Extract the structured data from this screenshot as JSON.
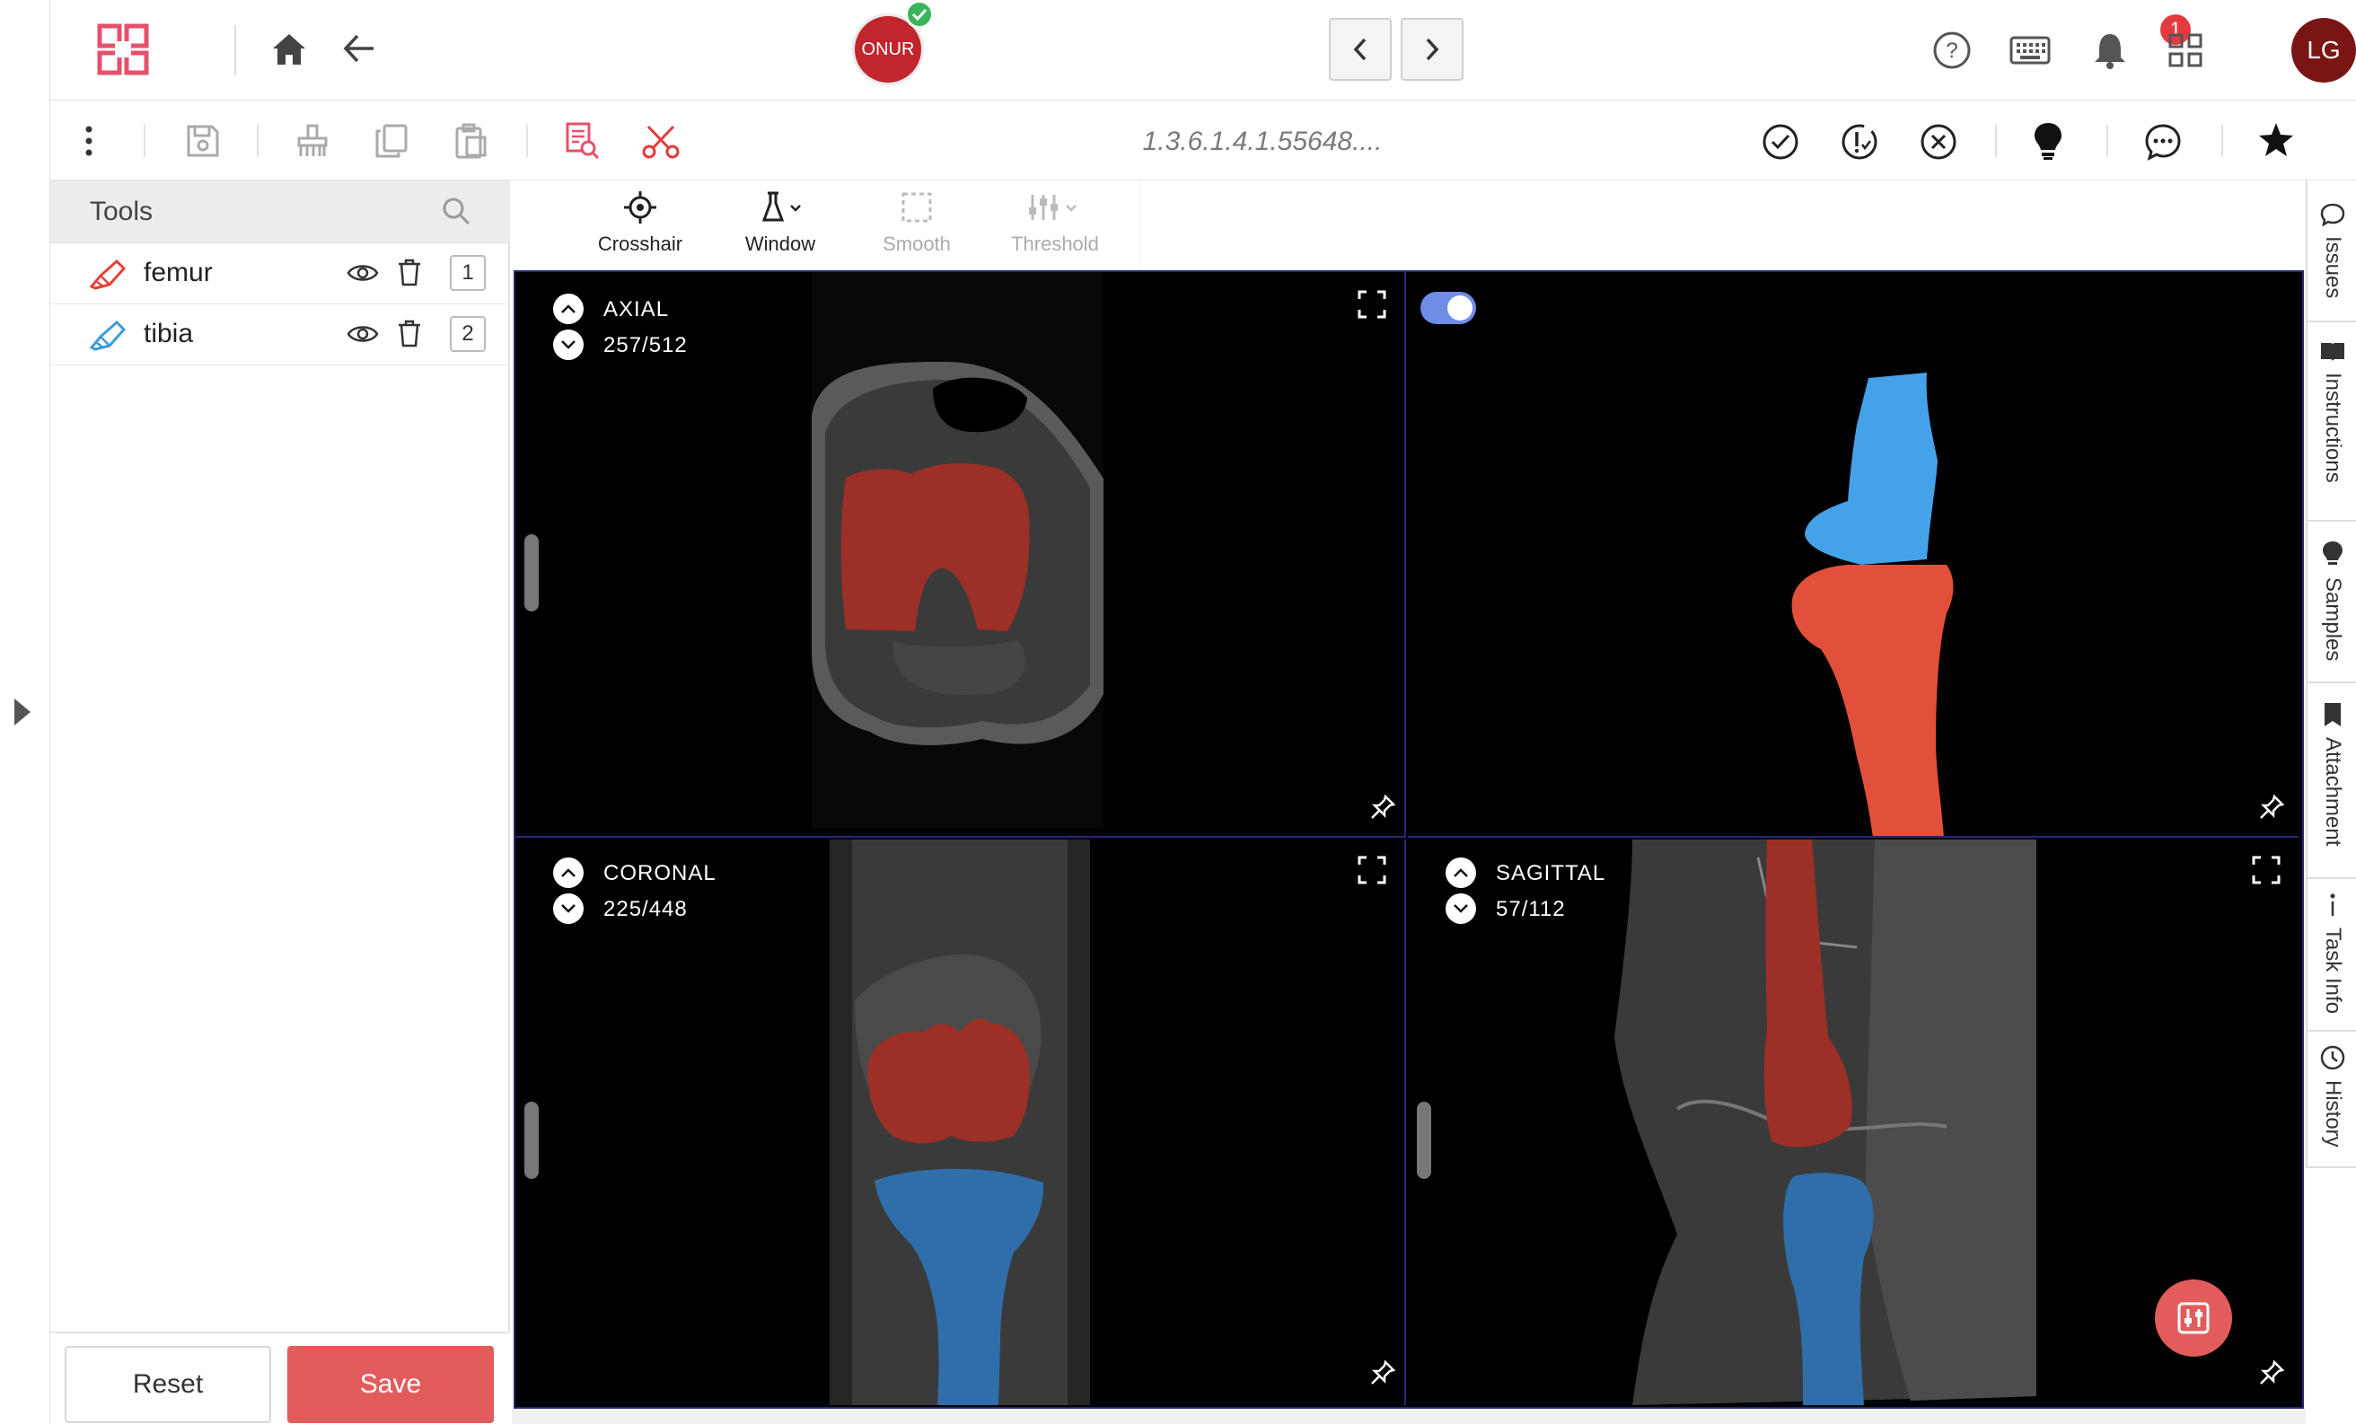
{
  "header": {
    "user_badge": "ONUR",
    "notification_count": "1",
    "avatar_initials": "LG"
  },
  "toolbar": {
    "study_uid": "1.3.6.1.4.1.55648...."
  },
  "tools": {
    "title": "Tools",
    "items": [
      {
        "name": "femur",
        "count": "1",
        "color": "#e2433a"
      },
      {
        "name": "tibia",
        "count": "2",
        "color": "#3d9be0"
      }
    ]
  },
  "actions": {
    "reset_label": "Reset",
    "save_label": "Save"
  },
  "view_tools": [
    {
      "label": "Crosshair",
      "enabled": true
    },
    {
      "label": "Window",
      "enabled": true
    },
    {
      "label": "Smooth",
      "enabled": false
    },
    {
      "label": "Threshold",
      "enabled": false
    }
  ],
  "viewports": {
    "axial": {
      "label": "AXIAL",
      "slice": "257/512"
    },
    "coronal": {
      "label": "CORONAL",
      "slice": "225/448"
    },
    "sagittal": {
      "label": "SAGITTAL",
      "slice": "57/112"
    },
    "render3d": {
      "toggle_on": true
    }
  },
  "side_tabs": [
    {
      "label": "Issues",
      "icon": "chat-icon"
    },
    {
      "label": "Instructions",
      "icon": "book-icon"
    },
    {
      "label": "Samples",
      "icon": "bulb-icon"
    },
    {
      "label": "Attachment",
      "icon": "bookmark-icon"
    },
    {
      "label": "Task Info",
      "icon": "info-icon"
    },
    {
      "label": "History",
      "icon": "clock-icon"
    }
  ],
  "colors": {
    "accent": "#e25c5c",
    "femur_mask": "#9c3026",
    "tibia_mask": "#2f6ea8",
    "femur_3d": "#e2503c",
    "tibia_3d": "#45a2e8"
  }
}
